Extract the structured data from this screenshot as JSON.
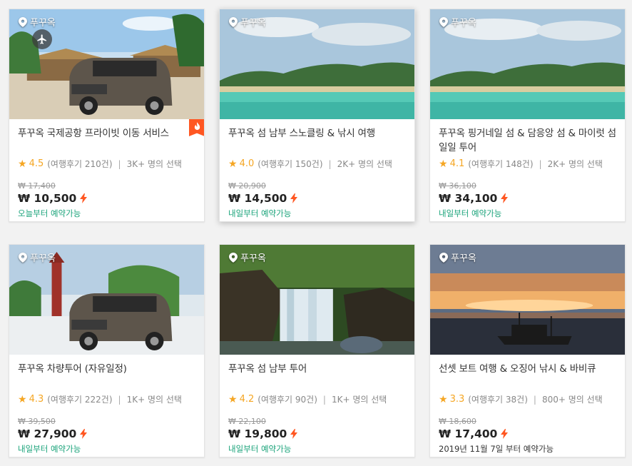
{
  "cards": [
    {
      "location": "푸꾸옥",
      "title": "푸꾸옥 국제공항 프라이빗 이동 서비스",
      "rating": "4.5",
      "reviews": "(여행후기 210건)",
      "selected": "3K+ 명의 선택",
      "old_price": "₩ 17,400",
      "price": "₩ 10,500",
      "availability": "오늘부터 예약가능",
      "icon": "plane-icon",
      "badge": "hot-badge"
    },
    {
      "location": "푸꾸옥",
      "title": "푸꾸옥 섬 남부 스노클링 & 낚시 여행",
      "rating": "4.0",
      "reviews": "(여행후기 150건)",
      "selected": "2K+ 명의 선택",
      "old_price": "₩ 20,900",
      "price": "₩ 14,500",
      "availability": "내일부터 예약가능"
    },
    {
      "location": "푸꾸옥",
      "title": "푸꾸옥 핑거네일 섬 & 담응앙 섬 & 마이럿 섬 일일 투어",
      "rating": "4.1",
      "reviews": "(여행후기 148건)",
      "selected": "2K+ 명의 선택",
      "old_price": "₩ 36,100",
      "price": "₩ 34,100",
      "availability": "내일부터 예약가능"
    },
    {
      "location": "푸꾸옥",
      "title": "푸꾸옥 차량투어 (자유일정)",
      "rating": "4.3",
      "reviews": "(여행후기 222건)",
      "selected": "1K+ 명의 선택",
      "old_price": "₩ 39,500",
      "price": "₩ 27,900",
      "availability": "내일부터 예약가능"
    },
    {
      "location": "푸꾸옥",
      "title": "푸꾸옥 섬 남부 투어",
      "rating": "4.2",
      "reviews": "(여행후기 90건)",
      "selected": "1K+ 명의 선택",
      "old_price": "₩ 22,100",
      "price": "₩ 19,800",
      "availability": "내일부터 예약가능"
    },
    {
      "location": "푸꾸옥",
      "title": "선셋 보트 여행 & 오징어 낚시 & 바비큐",
      "rating": "3.3",
      "reviews": "(여행후기 38건)",
      "selected": "800+ 명의 선택",
      "old_price": "₩ 18,600",
      "price": "₩ 17,400",
      "availability": "2019년 11월 7일 부터 예약가능"
    }
  ],
  "colors": {
    "star": "#f5a623",
    "price_bolt": "#ff5722",
    "availability": "#1aa37a"
  }
}
